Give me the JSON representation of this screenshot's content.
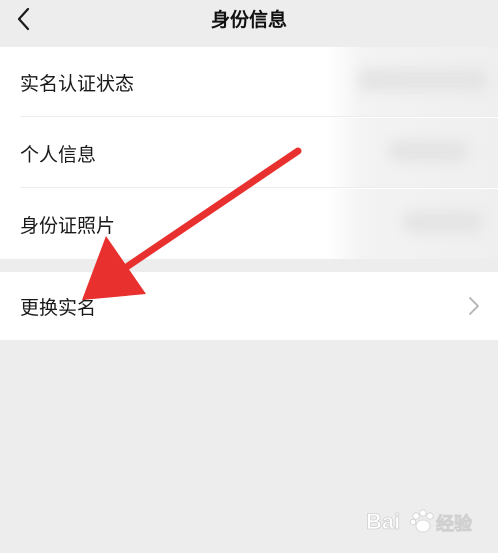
{
  "navbar": {
    "back_icon": "chevron-left-icon",
    "title": "身份信息"
  },
  "identity_rows": [
    {
      "label": "实名认证状态"
    },
    {
      "label": "个人信息"
    },
    {
      "label": "身份证照片"
    }
  ],
  "change_row": {
    "label": "更换实名",
    "icon": "chevron-right-icon"
  },
  "annotation": {
    "arrow_color": "#e8312f",
    "arrow_target": "change-realname-row"
  },
  "watermark": {
    "brand": "Baidu经验",
    "logo": "baidu-paw-logo"
  },
  "colors": {
    "background": "#ededed",
    "card": "#ffffff",
    "arrow": "#e8312f"
  }
}
